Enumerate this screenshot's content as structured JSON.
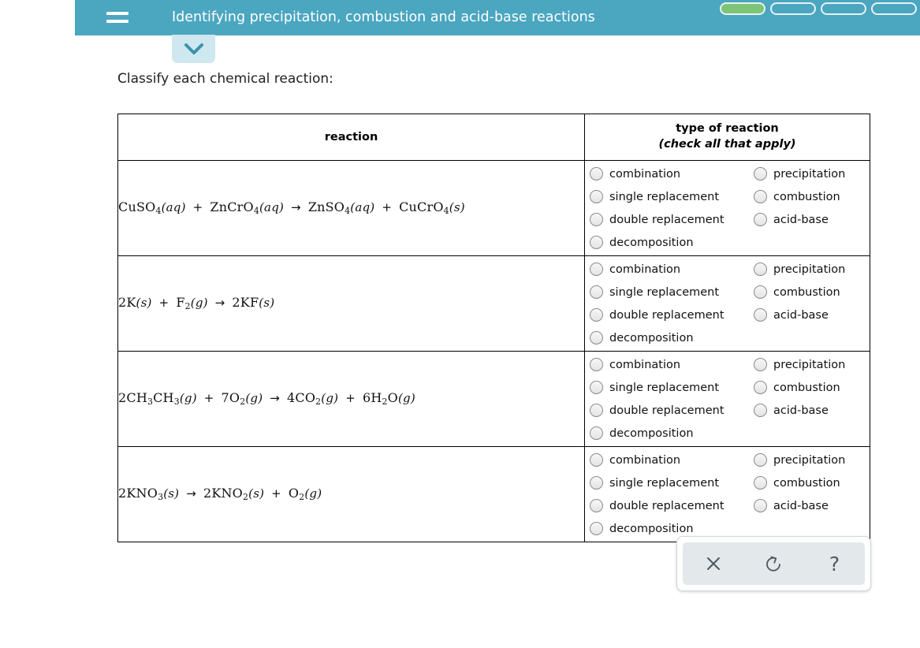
{
  "header": {
    "title": "Identifying precipitation, combustion and acid-base reactions",
    "menu_icon": "hamburger-icon",
    "accent_color": "#4ba6c0",
    "progress": {
      "total_segments": 5,
      "completed_segments": 1,
      "fill_color": "#7cc576"
    }
  },
  "expand_tab": {
    "icon": "chevron-down-icon",
    "background_color": "#cfe8ef"
  },
  "instruction": "Classify each chemical reaction:",
  "table": {
    "headers": {
      "reaction": "reaction",
      "type_main": "type of reaction",
      "type_sub": "(check all that apply)"
    },
    "options_left": [
      "combination",
      "single replacement",
      "double replacement",
      "decomposition"
    ],
    "options_right": [
      "precipitation",
      "combustion",
      "acid-base"
    ],
    "rows": [
      {
        "equation_plain": "CuSO4(aq) + ZnCrO4(aq) → ZnSO4(aq) + CuCrO4(s)",
        "equation_parts": [
          {
            "formula": "CuSO",
            "sub": "4",
            "state": "(aq)"
          },
          {
            "op": "+"
          },
          {
            "formula": "ZnCrO",
            "sub": "4",
            "state": "(aq)"
          },
          {
            "op": "→"
          },
          {
            "formula": "ZnSO",
            "sub": "4",
            "state": "(aq)"
          },
          {
            "op": "+"
          },
          {
            "formula": "CuCrO",
            "sub": "4",
            "state": "(s)"
          }
        ]
      },
      {
        "equation_plain": "2K(s) + F2(g) → 2KF(s)",
        "equation_parts": [
          {
            "formula": "2K",
            "sub": "",
            "state": "(s)"
          },
          {
            "op": "+"
          },
          {
            "formula": "F",
            "sub": "2",
            "state": "(g)"
          },
          {
            "op": "→"
          },
          {
            "formula": "2KF",
            "sub": "",
            "state": "(s)"
          }
        ]
      },
      {
        "equation_plain": "2CH3CH3(g) + 7O2(g) → 4CO2(g) + 6H2O(g)",
        "equation_parts": [
          {
            "formula": "2CH",
            "sub": "3",
            "formula2": "CH",
            "sub2": "3",
            "state": "(g)"
          },
          {
            "op": "+"
          },
          {
            "formula": "7O",
            "sub": "2",
            "state": "(g)"
          },
          {
            "op": "→"
          },
          {
            "formula": "4CO",
            "sub": "2",
            "state": "(g)"
          },
          {
            "op": "+"
          },
          {
            "formula": "6H",
            "sub": "2",
            "formula2": "O",
            "sub2": "",
            "state": "(g)"
          }
        ]
      },
      {
        "equation_plain": "2KNO3(s) → 2KNO2(s) + O2(g)",
        "equation_parts": [
          {
            "formula": "2KNO",
            "sub": "3",
            "state": "(s)"
          },
          {
            "op": "→"
          },
          {
            "formula": "2KNO",
            "sub": "2",
            "state": "(s)"
          },
          {
            "op": "+"
          },
          {
            "formula": "O",
            "sub": "2",
            "state": "(g)"
          }
        ]
      }
    ]
  },
  "toolbar": {
    "clear_label": "×",
    "undo_label": "↺",
    "help_label": "?",
    "clear_icon": "close-icon",
    "undo_icon": "refresh-ccw-icon",
    "help_icon": "question-mark-icon"
  }
}
